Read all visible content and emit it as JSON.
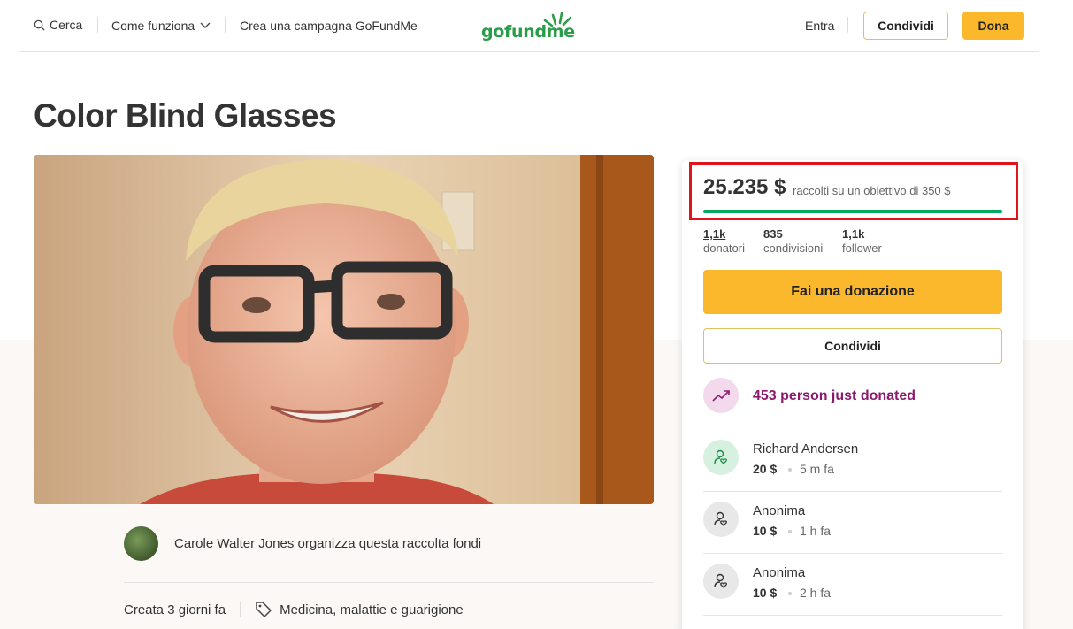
{
  "header": {
    "search_label": "Cerca",
    "how_label": "Come funziona",
    "create_label": "Crea una campagna GoFundMe",
    "logo_text": "gofundme",
    "login_label": "Entra",
    "share_label": "Condividi",
    "donate_label": "Dona"
  },
  "campaign": {
    "title": "Color Blind Glasses",
    "organizer_text": "Carole Walter Jones organizza questa raccolta fondi",
    "created": "Creata 3 giorni fa",
    "category": "Medicina, malattie e guarigione"
  },
  "donation": {
    "raised": "25.235 $",
    "goal_text": "raccolti su un obiettivo di 350 $",
    "progress_fraction": 1.0,
    "stats": [
      {
        "num": "1,1k",
        "label": "donatori"
      },
      {
        "num": "835",
        "label": "condivisioni"
      },
      {
        "num": "1,1k",
        "label": "follower"
      }
    ],
    "donate_button": "Fai una donazione",
    "share_button": "Condividi",
    "trend_text": "453 person just donated",
    "donors": [
      {
        "name": "Richard Andersen",
        "amount": "20 $",
        "time": "5 m fa"
      },
      {
        "name": "Anonima",
        "amount": "10 $",
        "time": "1 h fa"
      },
      {
        "name": "Anonima",
        "amount": "10 $",
        "time": "2 h fa"
      }
    ]
  },
  "colors": {
    "brand_green": "#02a95c",
    "cta_yellow": "#fbb82c",
    "highlight_red": "#e1141b",
    "trend_purple": "#8b1a6f"
  }
}
